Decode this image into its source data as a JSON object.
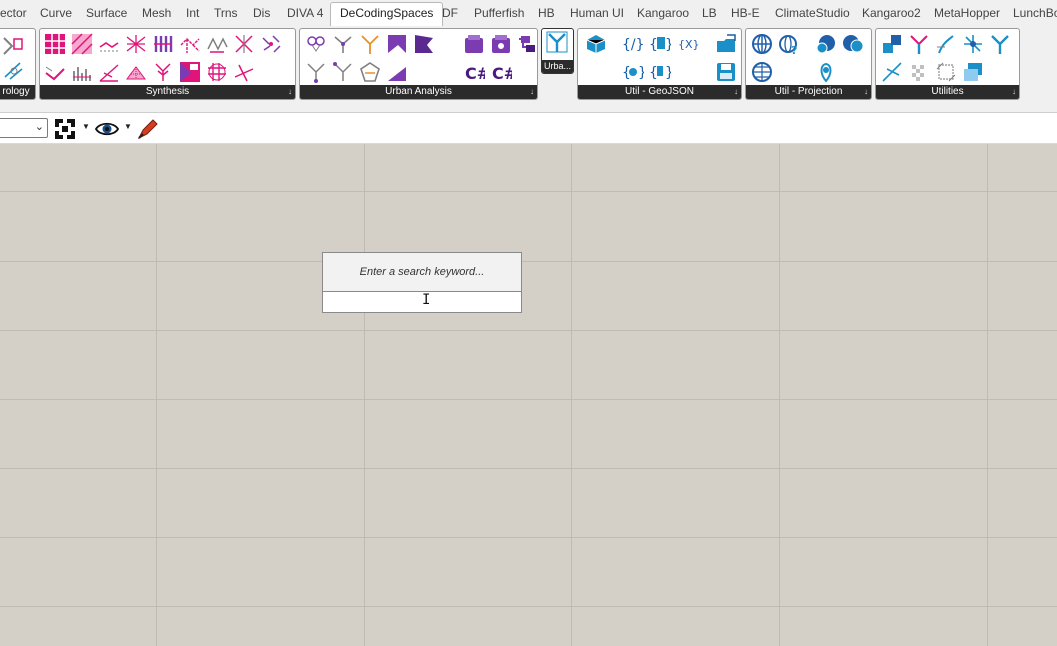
{
  "tabs": [
    {
      "label": "ector"
    },
    {
      "label": "Curve"
    },
    {
      "label": "Surface"
    },
    {
      "label": "Mesh"
    },
    {
      "label": "Int"
    },
    {
      "label": "Trns"
    },
    {
      "label": "Dis"
    },
    {
      "label": "DIVA 4"
    },
    {
      "label": "DeCodingSpaces",
      "active": true
    },
    {
      "label": "DF"
    },
    {
      "label": "Pufferfish"
    },
    {
      "label": "HB"
    },
    {
      "label": "Human UI"
    },
    {
      "label": "Kangaroo"
    },
    {
      "label": "LB"
    },
    {
      "label": "HB-E"
    },
    {
      "label": "ClimateStudio"
    },
    {
      "label": "Kangaroo2"
    },
    {
      "label": "MetaHopper"
    },
    {
      "label": "LunchBox"
    }
  ],
  "panels": [
    {
      "label": "rology"
    },
    {
      "label": "Synthesis"
    },
    {
      "label": "Urban Analysis"
    },
    {
      "label": "Urba..."
    },
    {
      "label": "Util - GeoJSON"
    },
    {
      "label": "Util - Projection"
    },
    {
      "label": "Utilities"
    }
  ],
  "panel_expand_glyph": "↓",
  "colors": {
    "magenta": "#e0147a",
    "purple": "#7a3cb0",
    "gray_icon": "#808080",
    "teal": "#1a8fc8",
    "blue_globe": "#2060a8",
    "canvas": "#d4d0c8"
  },
  "toolbar": {
    "icons": [
      "zoom-extents-icon",
      "preview-eye-icon",
      "sketch-pen-icon"
    ]
  },
  "search": {
    "hint": "Enter a search keyword...",
    "value": ""
  }
}
